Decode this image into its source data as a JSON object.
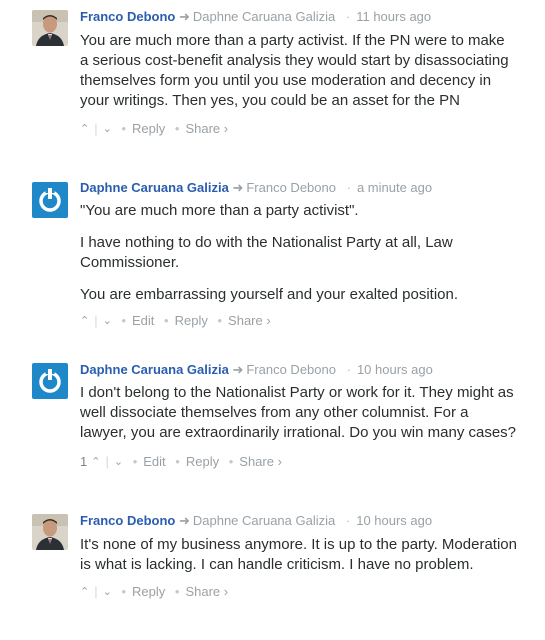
{
  "comments": [
    {
      "author": "Franco Debono",
      "reply_to": "Daphne Caruana Galizia",
      "time": "11 hours ago",
      "paragraphs": [
        "You are much more than a party activist. If the PN were to make a serious cost-benefit analysis they would start by disassociating themselves form you until you use moderation and decency in your writings. Then yes, you could be an asset for the PN"
      ],
      "actions": {
        "reply": "Reply",
        "share": "Share ›"
      }
    },
    {
      "author": "Daphne Caruana Galizia",
      "reply_to": "Franco Debono",
      "time": "a minute ago",
      "paragraphs": [
        "\"You are much more than a party activist\".",
        "I have nothing to do with the Nationalist Party at all, Law Commissioner.",
        "You are embarrassing yourself and your exalted position."
      ],
      "actions": {
        "edit": "Edit",
        "reply": "Reply",
        "share": "Share ›"
      }
    },
    {
      "author": "Daphne Caruana Galizia",
      "reply_to": "Franco Debono",
      "time": "10 hours ago",
      "paragraphs": [
        "I don't belong to the Nationalist Party or work for it. They might as well dissociate themselves from any other columnist. For a lawyer, you are extraordinarily irrational. Do you win many cases?"
      ],
      "actions": {
        "upvotes": "1",
        "edit": "Edit",
        "reply": "Reply",
        "share": "Share ›"
      }
    },
    {
      "author": "Franco Debono",
      "reply_to": "Daphne Caruana Galizia",
      "time": "10 hours ago",
      "paragraphs": [
        "It's none of my business anymore. It is up to the party. Moderation is what is lacking. I can handle criticism. I have no problem."
      ],
      "actions": {
        "reply": "Reply",
        "share": "Share ›"
      }
    }
  ],
  "glyphs": {
    "upvote": "⌃",
    "downvote": "⌄",
    "reply_arrow": "➜",
    "dot": "·",
    "bullet": "•"
  },
  "colors": {
    "author": "#2a5db0",
    "meta": "#9aa1a6",
    "logo_blue": "#1e88c8"
  }
}
